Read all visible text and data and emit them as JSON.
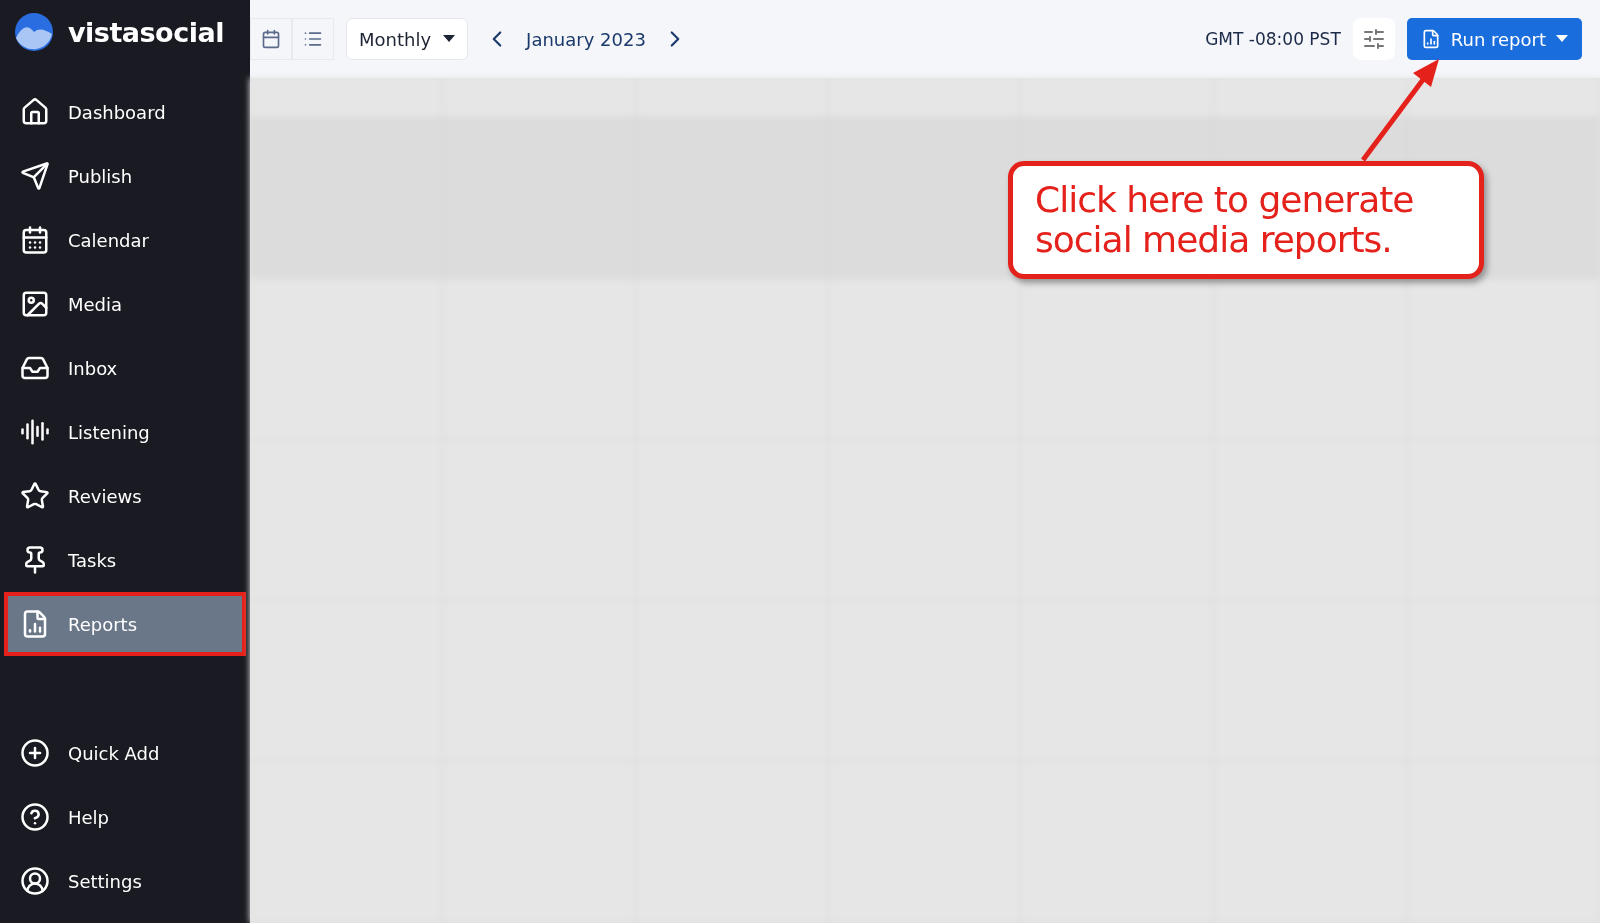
{
  "brand": {
    "name": "vistasocial"
  },
  "nav_items": [
    {
      "label": "Dashboard",
      "selected": false
    },
    {
      "label": "Publish",
      "selected": false
    },
    {
      "label": "Calendar",
      "selected": false
    },
    {
      "label": "Media",
      "selected": false
    },
    {
      "label": "Inbox",
      "selected": false
    },
    {
      "label": "Listening",
      "selected": false
    },
    {
      "label": "Reviews",
      "selected": false
    },
    {
      "label": "Tasks",
      "selected": false
    },
    {
      "label": "Reports",
      "selected": true
    }
  ],
  "bottom_items": [
    {
      "label": "Quick Add"
    },
    {
      "label": "Help"
    },
    {
      "label": "Settings"
    }
  ],
  "toolbar": {
    "view_mode": "Monthly",
    "period": "January 2023",
    "timezone": "GMT -08:00 PST",
    "run_button": "Run report"
  },
  "callout": {
    "text": "Click here to generate social media reports."
  }
}
